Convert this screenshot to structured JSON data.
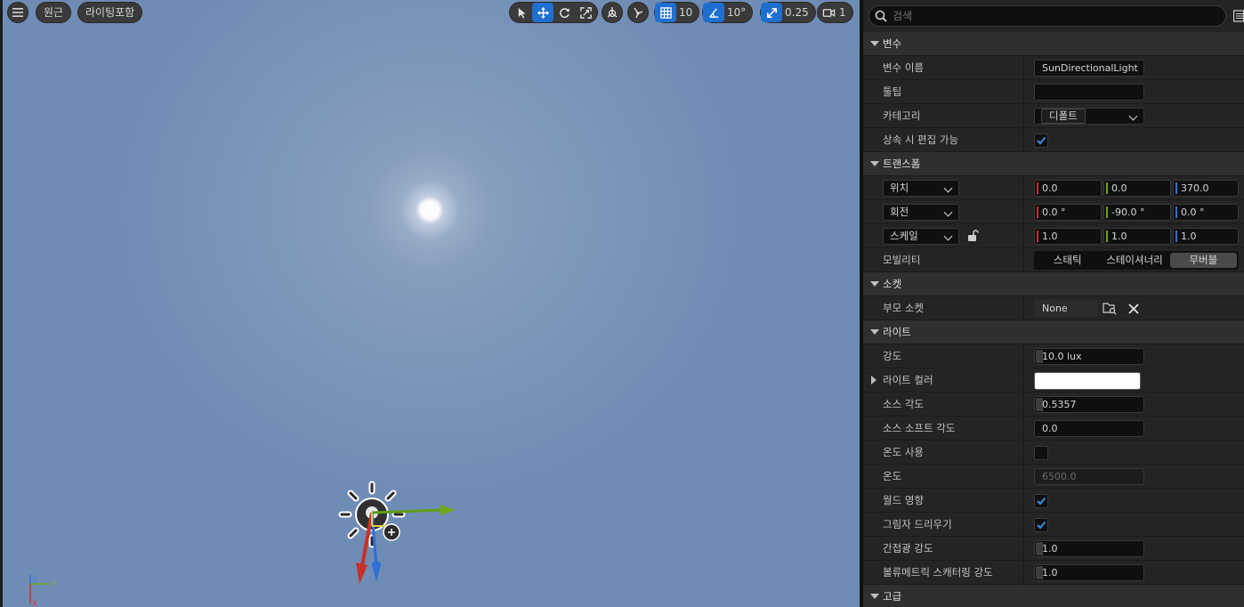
{
  "viewport": {
    "perspective_label": "원근",
    "view_mode_label": "라이팅포함",
    "grid_snap_value": "10",
    "rotation_snap_value": "10°",
    "scale_snap_value": "0.25",
    "camera_speed_value": "1",
    "axis_labels": {
      "z": "Z",
      "y": "Y",
      "x": "X"
    }
  },
  "details": {
    "search_placeholder": "검색",
    "sections": {
      "variable": "변수",
      "transform": "트랜스폼",
      "socket": "소켓",
      "light": "라이트",
      "advanced": "고급"
    },
    "variable": {
      "name_label": "변수 이름",
      "name_value": "SunDirectionalLight",
      "tooltip_label": "툴팁",
      "tooltip_value": "",
      "category_label": "카테고리",
      "category_value": "디폴트",
      "editable_label": "상속 시 편집 가능",
      "editable_checked": true
    },
    "transform": {
      "location_label": "위치",
      "location": [
        "0.0",
        "0.0",
        "370.0"
      ],
      "rotation_label": "회전",
      "rotation": [
        "0.0 °",
        "-90.0 °",
        "0.0 °"
      ],
      "scale_label": "스케일",
      "scale": [
        "1.0",
        "1.0",
        "1.0"
      ],
      "mobility_label": "모빌리티",
      "mobility_options": [
        "스태틱",
        "스테이셔너리",
        "무버블"
      ],
      "mobility_selected": "무버블"
    },
    "socket": {
      "parent_label": "부모 소켓",
      "parent_value": "None"
    },
    "light": {
      "intensity_label": "강도",
      "intensity_value": "10.0 lux",
      "color_label": "라이트 컬러",
      "color_value": "#ffffff",
      "source_angle_label": "소스 각도",
      "source_angle_value": "0.5357",
      "source_soft_angle_label": "소스 소프트 각도",
      "source_soft_angle_value": "0.0",
      "use_temperature_label": "온도 사용",
      "use_temperature_checked": false,
      "temperature_label": "온도",
      "temperature_value": "6500.0",
      "affects_world_label": "월드 영향",
      "affects_world_checked": true,
      "cast_shadows_label": "그림자 드리우기",
      "cast_shadows_checked": true,
      "indirect_intensity_label": "간접광 강도",
      "indirect_intensity_value": "1.0",
      "volumetric_intensity_label": "볼류메트릭 스캐터링 강도",
      "volumetric_intensity_value": "1.0"
    }
  },
  "colors": {
    "accent": "#1f6fd1",
    "axis_x": "#c8302a",
    "axis_y": "#6fa51f",
    "axis_z": "#2f6fd8"
  }
}
